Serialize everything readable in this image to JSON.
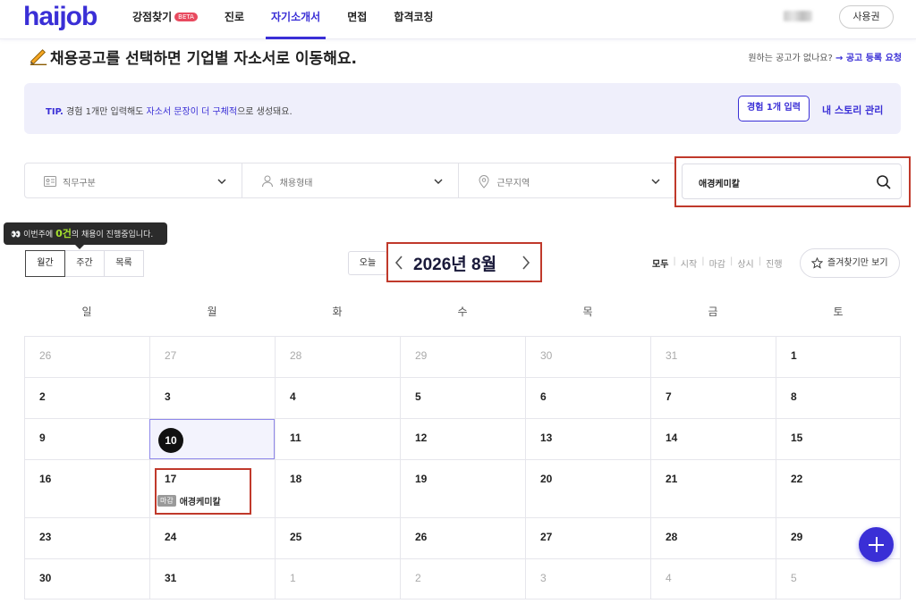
{
  "header": {
    "logo": "haijob",
    "nav": [
      {
        "label": "강점찾기",
        "badge": "BETA"
      },
      {
        "label": "진로"
      },
      {
        "label": "자기소개서",
        "active": true
      },
      {
        "label": "면접"
      },
      {
        "label": "합격코칭"
      }
    ],
    "voucher_label": "사용권"
  },
  "title": "채용공고를 선택하면 기업별 자소서로 이동해요.",
  "request": {
    "question": "원하는 공고가 없나요?",
    "cta": "→ 공고 등록 요청"
  },
  "tip": {
    "prefix": "TIP.",
    "text_a": " 경험 1개만 입력해도 ",
    "highlight": "자소서 문장이 더 구체적",
    "text_b": "으로 생성돼요.",
    "button": "경험 1개 입력",
    "link": "내 스토리 관리"
  },
  "filters": [
    {
      "label": "직무구분",
      "icon": "job-category-icon"
    },
    {
      "label": "채용형태",
      "icon": "person-icon"
    },
    {
      "label": "근무지역",
      "icon": "location-pin-icon"
    }
  ],
  "search": {
    "value": "애경케미칼"
  },
  "tooltip": {
    "emoji": "👀",
    "a": " 이번주에 ",
    "count": "0건",
    "b": "의 채용이 진행중입니다."
  },
  "views": [
    "월간",
    "주간",
    "목록"
  ],
  "calendar_nav": {
    "today": "오늘",
    "month": "2026년 8월"
  },
  "status_filters": [
    "모두",
    "시작",
    "마감",
    "상시",
    "진행"
  ],
  "fav_button": "즐겨찾기만 보기",
  "weekdays": [
    "일",
    "월",
    "화",
    "수",
    "목",
    "금",
    "토"
  ],
  "weeks": [
    [
      "26",
      "27",
      "28",
      "29",
      "30",
      "31",
      "1"
    ],
    [
      "2",
      "3",
      "4",
      "5",
      "6",
      "7",
      "8"
    ],
    [
      "9",
      "10",
      "11",
      "12",
      "13",
      "14",
      "15"
    ],
    [
      "16",
      "17",
      "18",
      "19",
      "20",
      "21",
      "22"
    ],
    [
      "23",
      "24",
      "25",
      "26",
      "27",
      "28",
      "29"
    ],
    [
      "30",
      "31",
      "1",
      "2",
      "3",
      "4",
      "5"
    ]
  ],
  "today_day": "10",
  "event": {
    "tag": "마감",
    "name": "애경케미칼"
  },
  "colors": {
    "brand": "#3a2fd6",
    "highlight_red": "#c0392b"
  }
}
